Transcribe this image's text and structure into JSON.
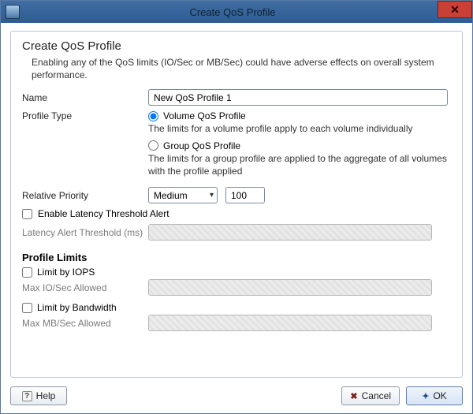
{
  "window": {
    "title": "Create QoS Profile"
  },
  "panel": {
    "title": "Create QoS Profile",
    "description": "Enabling any of the QoS limits (IO/Sec or MB/Sec) could have adverse effects on overall system performance."
  },
  "form": {
    "name_label": "Name",
    "name_value": "New QoS Profile 1",
    "profile_type_label": "Profile Type",
    "volume_radio_label": "Volume QoS Profile",
    "volume_help": "The limits for a volume profile apply to each volume individually",
    "group_radio_label": "Group QoS Profile",
    "group_help": "The limits for a group profile are applied to the aggregate of all volumes with the profile applied",
    "priority_label": "Relative Priority",
    "priority_value": "Medium",
    "priority_numeric": "100",
    "latency_enable_label": "Enable Latency Threshold Alert",
    "latency_threshold_label": "Latency Alert Threshold (ms)"
  },
  "limits": {
    "section_title": "Profile Limits",
    "iops_label": "Limit by IOPS",
    "iops_sub_label": "Max IO/Sec Allowed",
    "bw_label": "Limit by Bandwidth",
    "bw_sub_label": "Max MB/Sec Allowed"
  },
  "footer": {
    "help": "Help",
    "cancel": "Cancel",
    "ok": "OK"
  }
}
